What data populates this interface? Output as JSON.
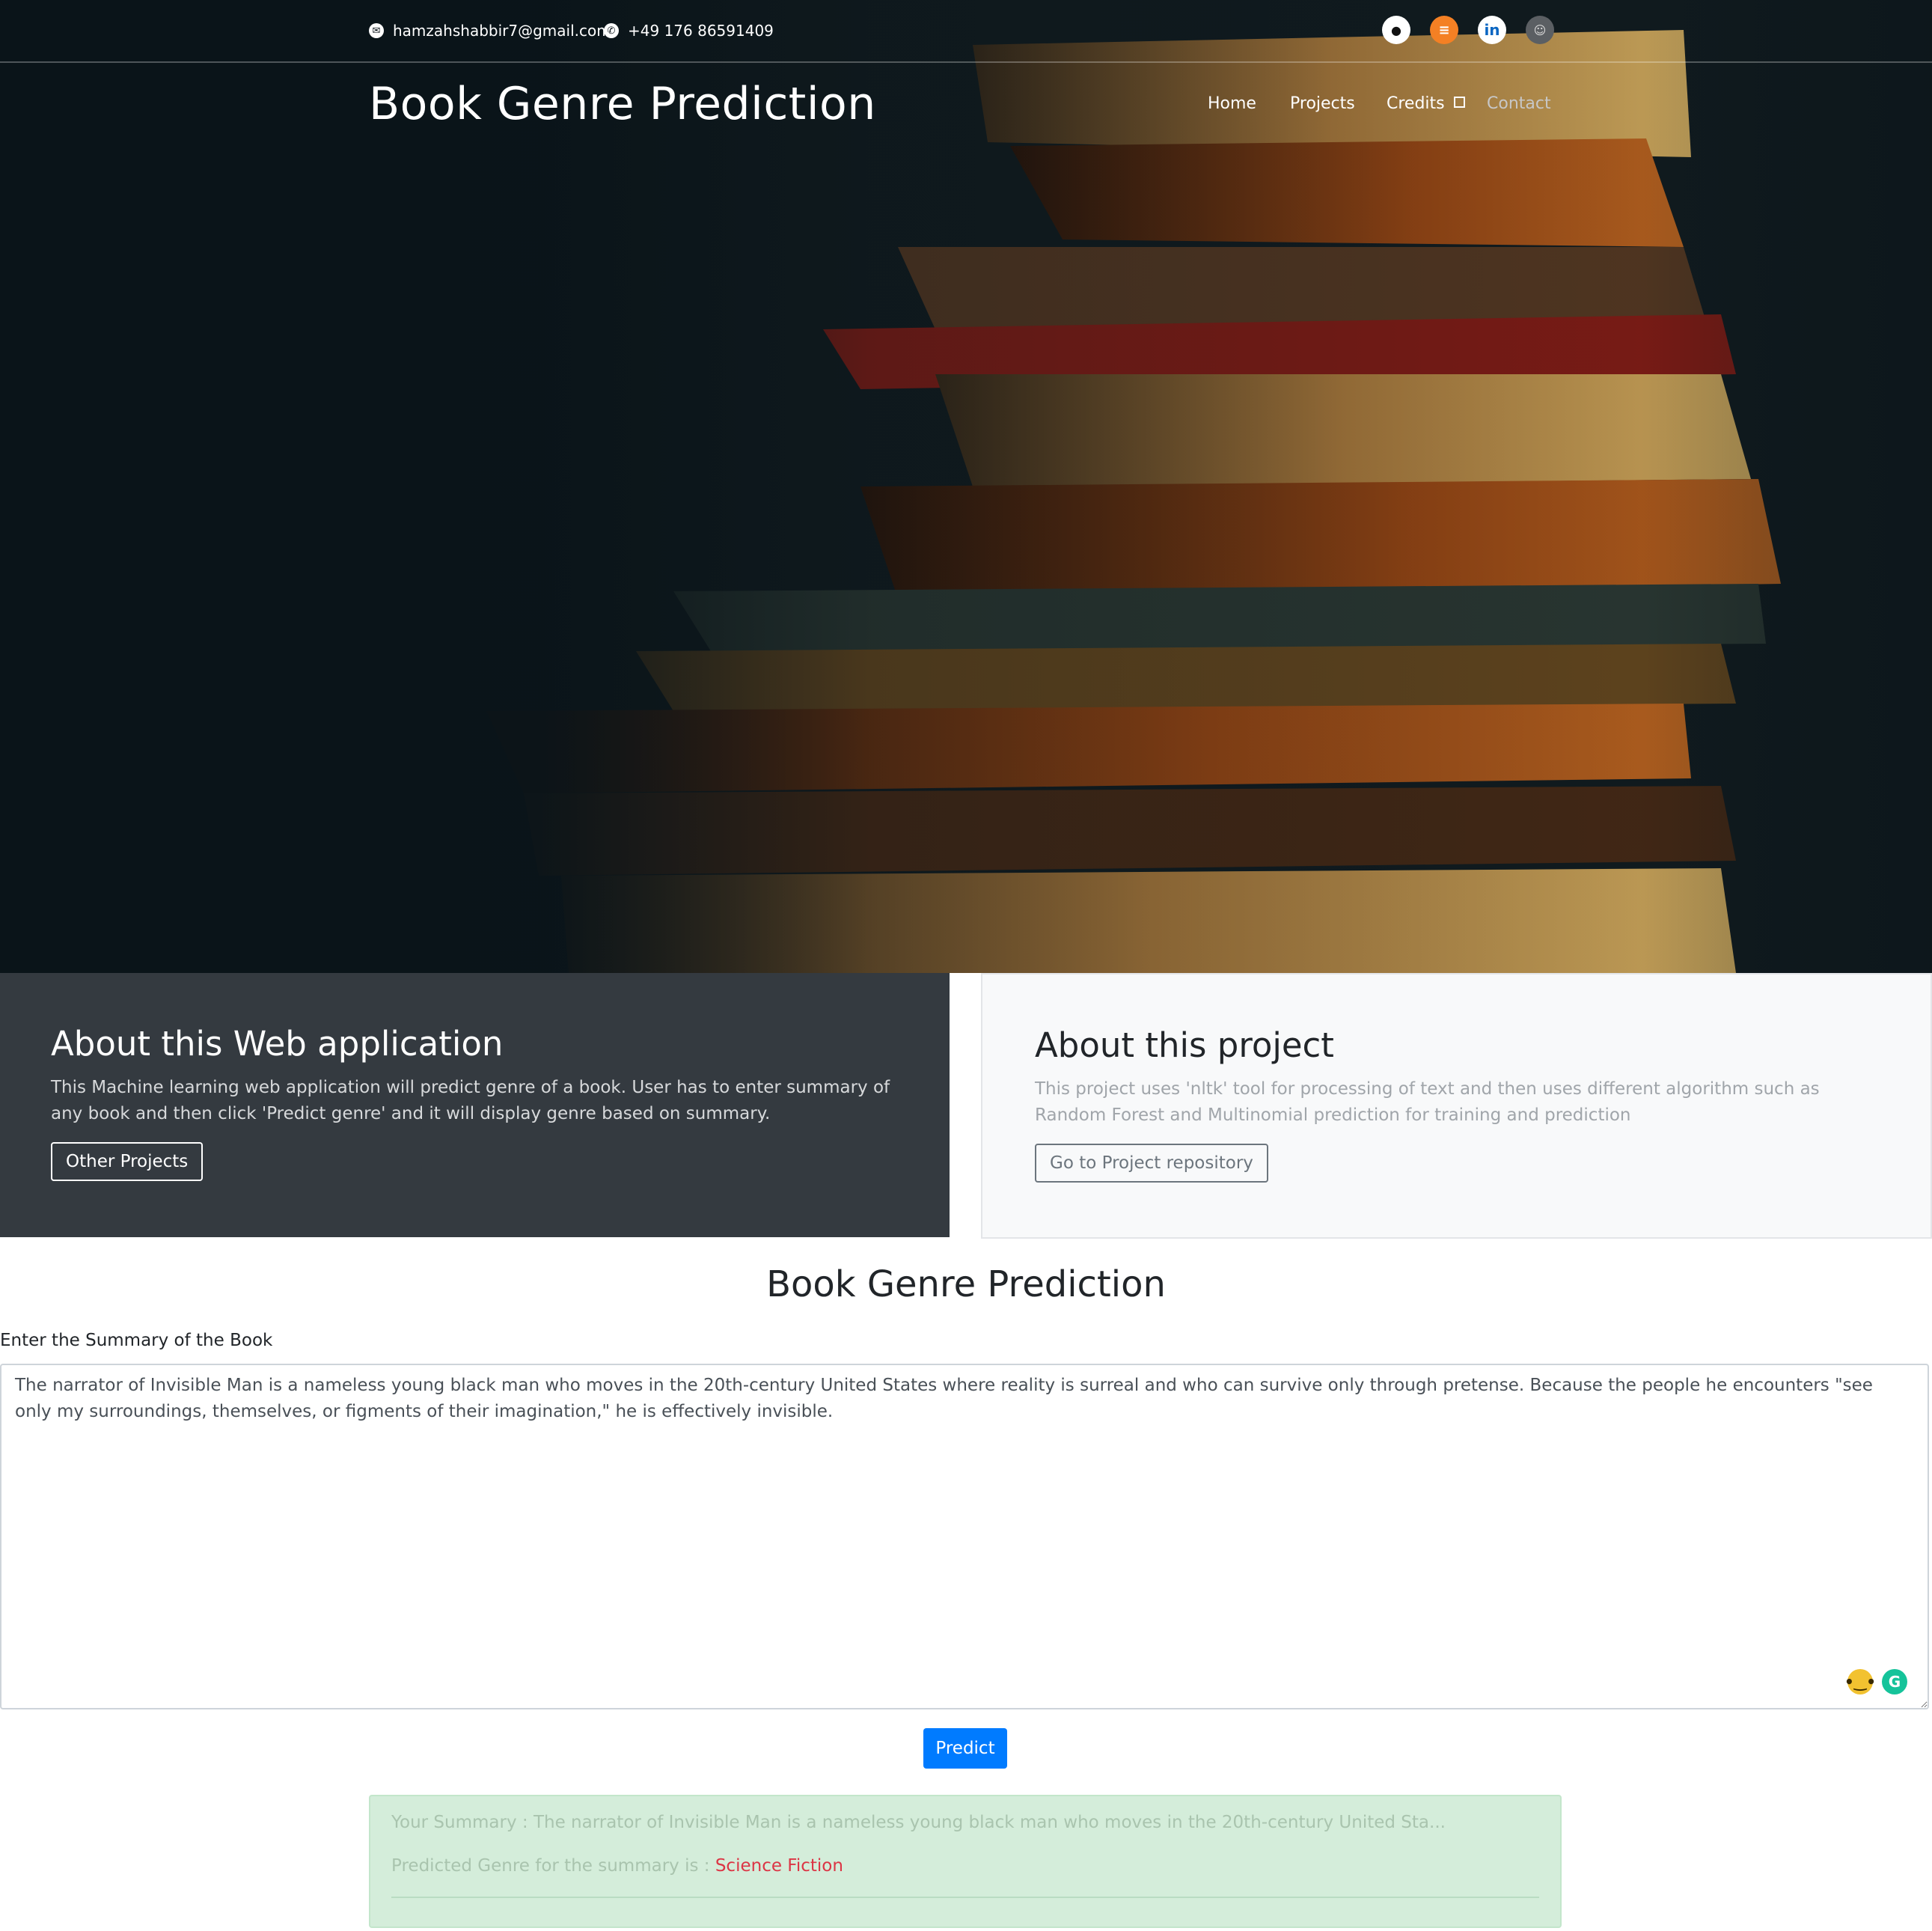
{
  "header": {
    "email": "hamzahshabbir7@gmail.com",
    "phone": "+49 176 86591409",
    "social_icons": [
      "github-icon",
      "stackoverflow-icon",
      "linkedin-icon",
      "profile-avatar-icon"
    ]
  },
  "navbar": {
    "brand": "Book Genre Prediction",
    "items": [
      {
        "label": "Home"
      },
      {
        "label": "Projects"
      },
      {
        "label": "Credits"
      },
      {
        "label": "Contact"
      }
    ]
  },
  "about_app": {
    "title": "About this Web application",
    "text": "This Machine learning web application will predict genre of a book. User has to enter summary of any book and then click 'Predict genre' and it will display genre based on summary.",
    "button": "Other Projects"
  },
  "about_project": {
    "title": "About this project",
    "text": "This project uses 'nltk' tool for processing of text and then uses different algorithm such as Random Forest and Multinomial prediction for training and prediction",
    "button": "Go to Project repository"
  },
  "form": {
    "title": "Book Genre Prediction",
    "label": "Enter the Summary of the Book",
    "summary_value": "The narrator of Invisible Man is a nameless young black man who moves in the 20th-century United States where reality is surreal and who can survive only through pretense. Because the people he encounters \"see only my surroundings, themselves, or figments of their imagination,\" he is effectively invisible.",
    "predict_button": "Predict"
  },
  "result": {
    "summary_label": "Your Summary : ",
    "summary_text": "The narrator of Invisible Man is a nameless young black man who moves in the 20th-century United Sta...",
    "genre_label": "Predicted Genre for the summary is : ",
    "genre_value": "Science Fiction"
  },
  "colors": {
    "primary": "#007bff",
    "dark_panel": "#343a40",
    "light_panel": "#f8f9fa",
    "alert_success_bg": "#d4edda",
    "genre_text": "#dc3545"
  }
}
